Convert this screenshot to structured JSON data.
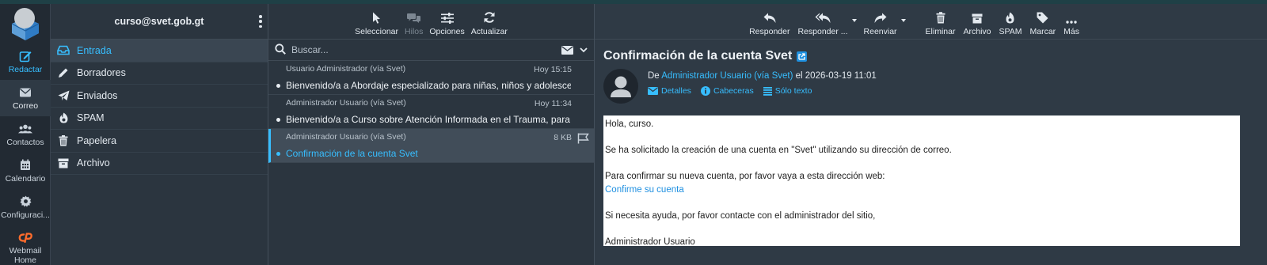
{
  "app": {
    "nav": [
      {
        "label": "Redactar",
        "icon": "compose-icon"
      },
      {
        "label": "Correo",
        "icon": "mail-icon"
      },
      {
        "label": "Contactos",
        "icon": "contacts-icon"
      },
      {
        "label": "Calendario",
        "icon": "calendar-icon"
      },
      {
        "label": "Configuraci...",
        "icon": "settings-icon"
      },
      {
        "label": "Webmail Home",
        "icon": "cpanel-icon"
      }
    ]
  },
  "account": "curso@svet.gob.gt",
  "folders": [
    {
      "label": "Entrada",
      "icon": "inbox-icon"
    },
    {
      "label": "Borradores",
      "icon": "pencil-icon"
    },
    {
      "label": "Enviados",
      "icon": "send-icon"
    },
    {
      "label": "SPAM",
      "icon": "fire-icon"
    },
    {
      "label": "Papelera",
      "icon": "trash-icon"
    },
    {
      "label": "Archivo",
      "icon": "archive-icon"
    }
  ],
  "list_toolbar": {
    "select": "Seleccionar",
    "threads": "Hilos",
    "options": "Opciones",
    "refresh": "Actualizar"
  },
  "search": {
    "placeholder": "Buscar..."
  },
  "messages": [
    {
      "from": "Usuario Administrador (vía Svet)",
      "date": "Hoy 15:15",
      "subject": "Bienvenido/a a Abordaje especializado para niñas, niños y adolescentes ..."
    },
    {
      "from": "Administrador Usuario (vía Svet)",
      "date": "Hoy 11:34",
      "subject": "Bienvenido/a a Curso sobre Atención Informada en el Trauma, para el A..."
    },
    {
      "from": "Administrador Usuario (vía Svet)",
      "date": "8 KB",
      "subject": "Confirmación de la cuenta Svet"
    }
  ],
  "read_toolbar": {
    "reply": "Responder",
    "reply_all": "Responder ...",
    "forward": "Reenviar",
    "delete": "Eliminar",
    "archive": "Archivo",
    "spam": "SPAM",
    "mark": "Marcar",
    "more": "Más"
  },
  "email": {
    "subject": "Confirmación de la cuenta Svet",
    "from_prefix": "De",
    "from_name": "Administrador Usuario (vía Svet)",
    "date_text": "el 2026-03-19 11:01",
    "details": "Detalles",
    "headers": "Cabeceras",
    "plain": "Sólo texto",
    "body": {
      "greeting": "Hola, curso.",
      "line1": "Se ha solicitado la creación de una cuenta en \"Svet\" utilizando su dirección de correo.",
      "line2": "Para confirmar su nueva cuenta, por favor vaya a esta dirección web:",
      "link": "Confirme su cuenta",
      "line3": "Si necesita ayuda, por favor contacte con el administrador del sitio,",
      "signature": "Administrador Usuario"
    }
  },
  "colors": {
    "accent": "#37beff",
    "background": "#2f3a45",
    "sidebar": "#222a33"
  }
}
